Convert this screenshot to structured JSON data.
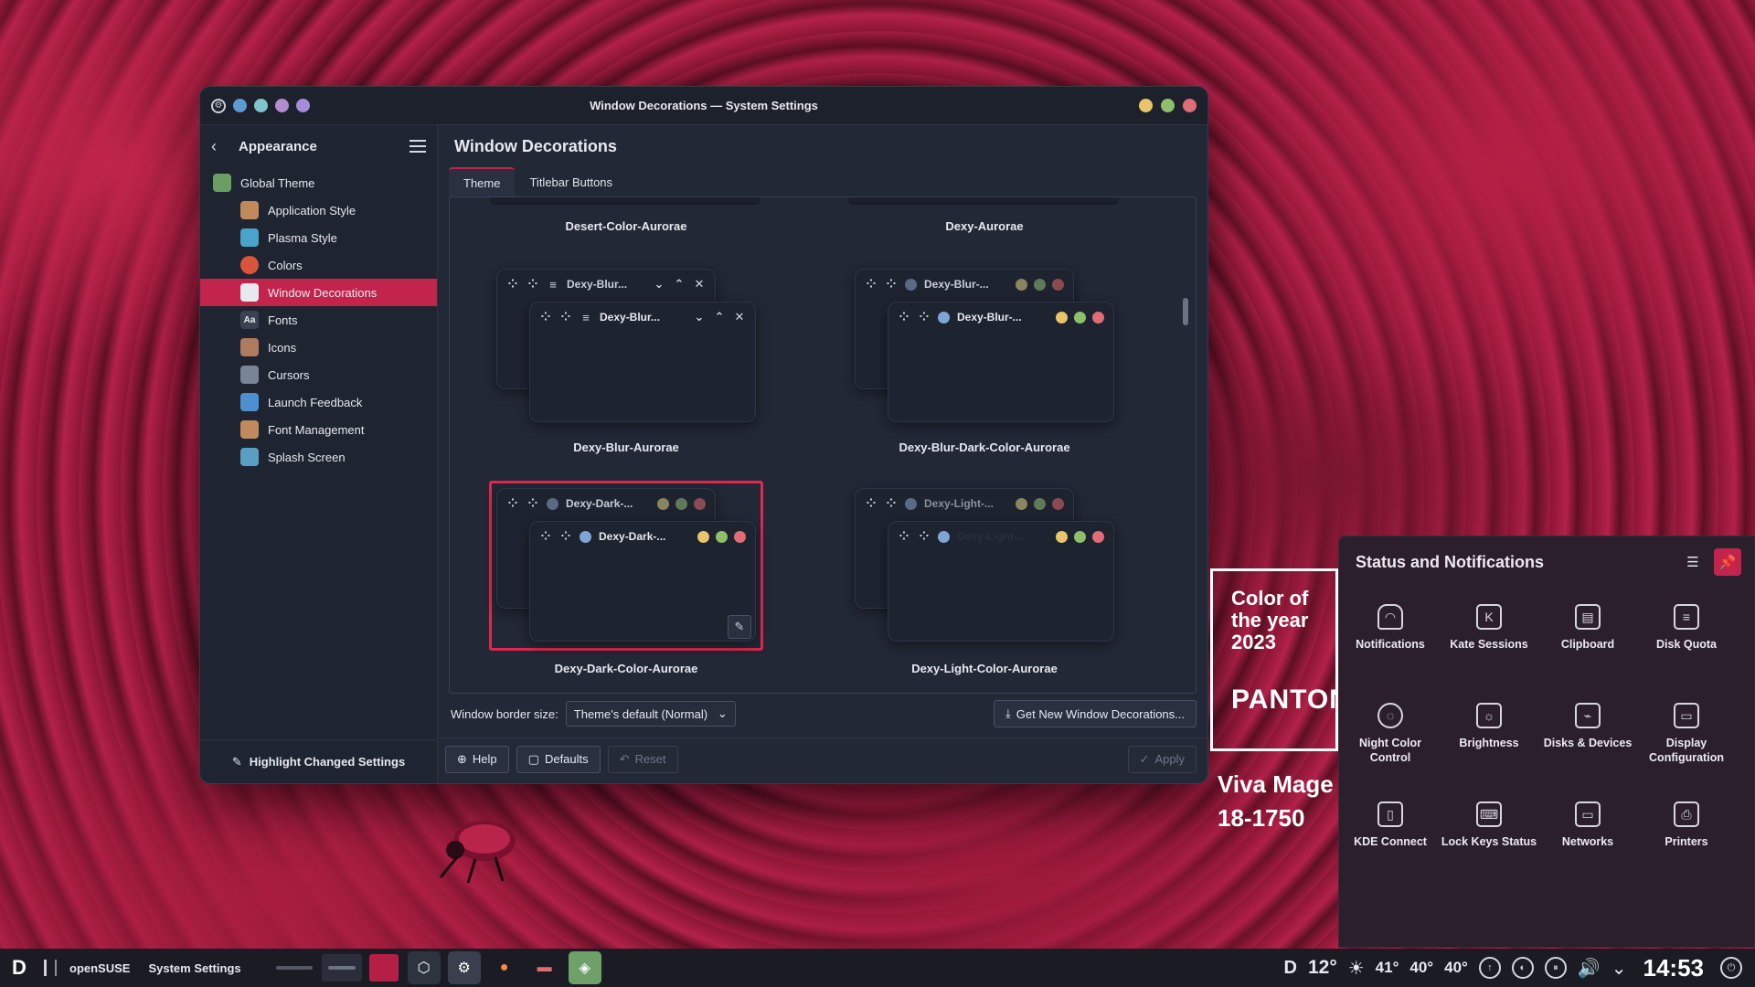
{
  "window": {
    "title": "Window Decorations — System Settings",
    "title_dots": [
      "#5b9bd5",
      "#7fc4cf",
      "#b38ccf",
      "#a58bdb"
    ],
    "control_dots": [
      "#e9c46a",
      "#8fbf6b",
      "#e06c75"
    ]
  },
  "sidebar": {
    "back_label": "Appearance",
    "items": [
      {
        "label": "Global Theme",
        "icon": "GT",
        "color": "#6a9e62",
        "level": 0
      },
      {
        "label": "Application Style",
        "icon": "AS",
        "color": "#c28a5a",
        "level": 1
      },
      {
        "label": "Plasma Style",
        "icon": "PS",
        "color": "#4aa3c8",
        "level": 1
      },
      {
        "label": "Colors",
        "icon": "C",
        "color": "#d8553c",
        "level": 1
      },
      {
        "label": "Window Decorations",
        "icon": "WD",
        "color": "#e6e9ef",
        "level": 1
      },
      {
        "label": "Fonts",
        "icon": "Aa",
        "color": "#3b4150",
        "level": 1
      },
      {
        "label": "Icons",
        "icon": "IC",
        "color": "#b07a5e",
        "level": 1
      },
      {
        "label": "Cursors",
        "icon": "CU",
        "color": "#7a8497",
        "level": 1
      },
      {
        "label": "Launch Feedback",
        "icon": "LF",
        "color": "#4d8fd1",
        "level": 1
      },
      {
        "label": "Font Management",
        "icon": "FM",
        "color": "#c08a5c",
        "level": 1
      },
      {
        "label": "Splash Screen",
        "icon": "SS",
        "color": "#5a9ec4",
        "level": 1
      }
    ],
    "footer_label": "Highlight Changed Settings"
  },
  "main": {
    "title": "Window Decorations",
    "tabs": [
      "Theme",
      "Titlebar Buttons"
    ],
    "themes": [
      {
        "name": "Desert-Color-Aurorae",
        "preview_title": ""
      },
      {
        "name": "Dexy-Aurorae",
        "preview_title": ""
      },
      {
        "name": "Dexy-Blur-Aurorae",
        "preview_title": "Dexy-Blur..."
      },
      {
        "name": "Dexy-Blur-Dark-Color-Aurorae",
        "preview_title": "Dexy-Blur-..."
      },
      {
        "name": "Dexy-Dark-Color-Aurorae",
        "preview_title": "Dexy-Dark-..."
      },
      {
        "name": "Dexy-Light-Color-Aurorae",
        "preview_title": "Dexy-Light-..."
      }
    ],
    "border_size_label": "Window border size:",
    "border_size_value": "Theme's default (Normal)",
    "get_new_label": "Get New Window Decorations...",
    "buttons": {
      "help": "Help",
      "defaults": "Defaults",
      "reset": "Reset",
      "apply": "Apply"
    }
  },
  "poster": {
    "title_lines": [
      "Color of",
      "the year",
      "2023"
    ],
    "brand": "PANTON",
    "sub_lines": [
      "Viva Mage",
      "18-1750"
    ]
  },
  "notifications": {
    "title": "Status and Notifications",
    "items": [
      {
        "label": "Notifications",
        "icon": "bell-icon",
        "glyph": "🔔"
      },
      {
        "label": "Kate Sessions",
        "icon": "kate-icon",
        "glyph": "K"
      },
      {
        "label": "Clipboard",
        "icon": "clipboard-icon",
        "glyph": "▤"
      },
      {
        "label": "Disk Quota",
        "icon": "disk-quota-icon",
        "glyph": "≡"
      },
      {
        "label": "Night Color Control",
        "icon": "lightbulb-icon",
        "glyph": "◌"
      },
      {
        "label": "Brightness",
        "icon": "brightness-icon",
        "glyph": "☼"
      },
      {
        "label": "Disks & Devices",
        "icon": "usb-icon",
        "glyph": "⌁"
      },
      {
        "label": "Display Configuration",
        "icon": "display-icon",
        "glyph": "▭"
      },
      {
        "label": "KDE Connect",
        "icon": "phone-icon",
        "glyph": "▯"
      },
      {
        "label": "Lock Keys Status",
        "icon": "keyboard-icon",
        "glyph": "⌨"
      },
      {
        "label": "Networks",
        "icon": "network-icon",
        "glyph": "▭"
      },
      {
        "label": "Printers",
        "icon": "printer-icon",
        "glyph": "⎙"
      }
    ]
  },
  "taskbar": {
    "distro": "openSUSE",
    "app": "System Settings",
    "weather_temp": "12°",
    "temps": [
      "41°",
      "40°",
      "40°"
    ],
    "clock": "14:53"
  }
}
